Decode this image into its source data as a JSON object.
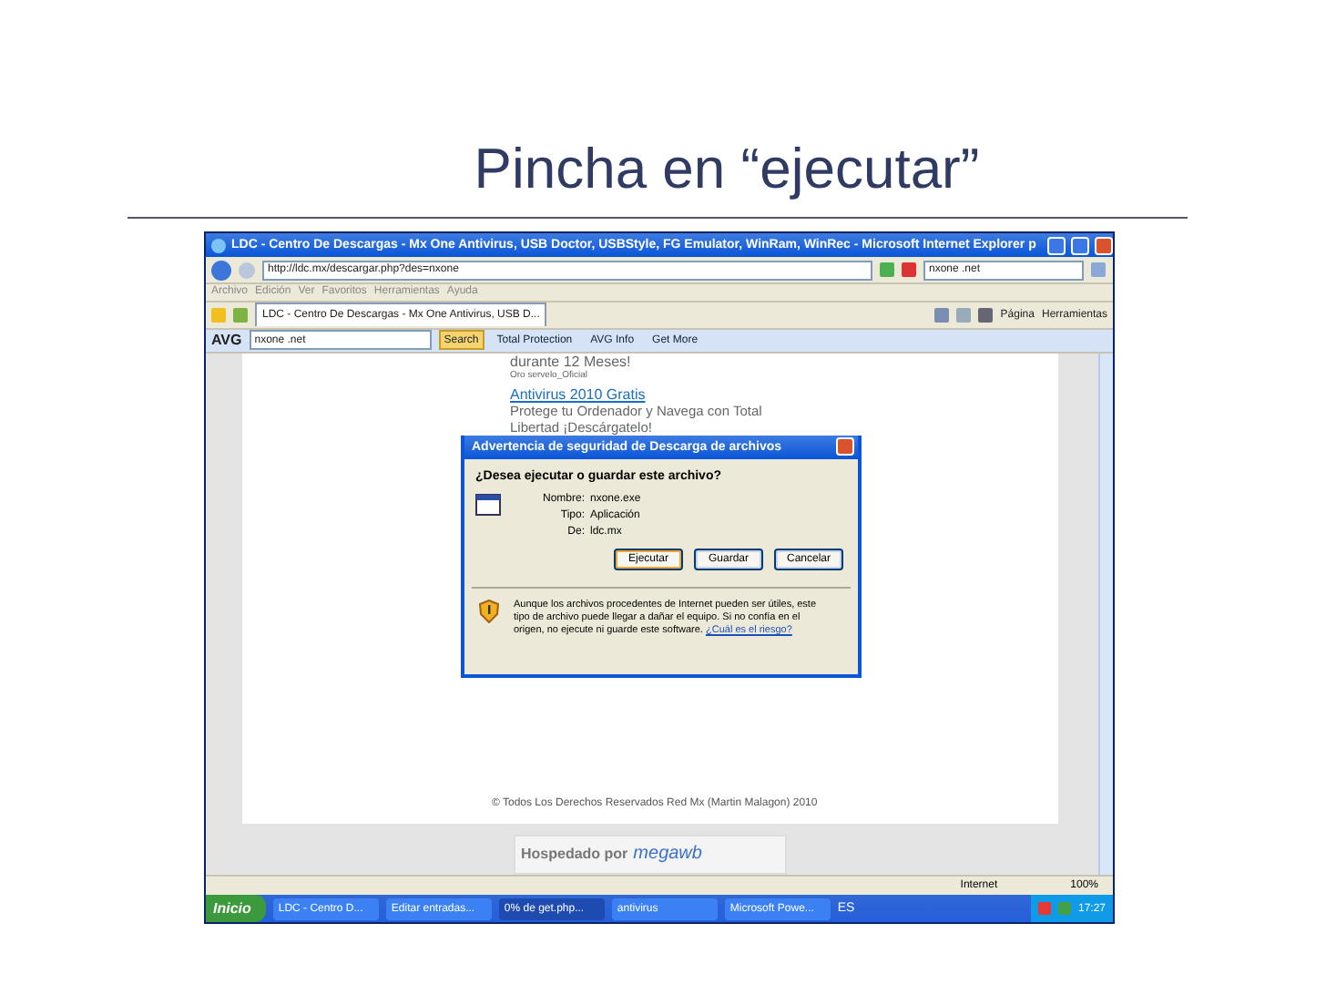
{
  "slide": {
    "title": "Pincha en “ejecutar”"
  },
  "browser": {
    "title": "LDC - Centro De Descargas - Mx One Antivirus, USB Doctor, USBStyle, FG Emulator, WinRam, WinRec - Microsoft Internet Explorer p",
    "address": "http://ldc.mx/descargar.php?des=nxone",
    "search_value": "nxone .net",
    "menu": [
      "Archivo",
      "Edición",
      "Ver",
      "Favoritos",
      "Herramientas",
      "Ayuda"
    ],
    "tab_title": "LDC - Centro De Descargas - Mx One Antivirus, USB D...",
    "commands": [
      "Página",
      "Herramientas"
    ],
    "avg": {
      "brand": "AVG",
      "search_value": "nxone .net",
      "buttons": [
        "Search",
        "Total Protection",
        "AVG Info",
        "Get More"
      ]
    }
  },
  "page": {
    "promo_text": "durante 12 Meses!",
    "promo_source": "Oro servelo_Oficial",
    "link": "Antivirus 2010 Gratis",
    "body": "Protege tu Ordenador y Navega con Total Libertad ¡Descárgatelo!",
    "footer": "© Todos Los Derechos Reservados Red Mx (Martin Malagon) 2010",
    "sponsor_label": "Hospedado por",
    "sponsor_logo": "megawb"
  },
  "dialog": {
    "title": "Advertencia de seguridad de Descarga de archivos",
    "question": "¿Desea ejecutar o guardar este archivo?",
    "fields": [
      {
        "label": "Nombre:",
        "value": "nxone.exe"
      },
      {
        "label": "Tipo:",
        "value": "Aplicación"
      },
      {
        "label": "De:",
        "value": "ldc.mx"
      }
    ],
    "buttons": [
      {
        "label": "Ejecutar",
        "selected": true
      },
      {
        "label": "Guardar",
        "selected": false
      },
      {
        "label": "Cancelar",
        "selected": false
      }
    ],
    "warning": "Aunque los archivos procedentes de Internet pueden ser útiles, este tipo de archivo puede llegar a dañar el equipo. Si no confía en el origen, no ejecute ni guarde este software.",
    "warning_link": "¿Cuál es el riesgo?"
  },
  "status": {
    "zone": "Internet",
    "zoom": "100%"
  },
  "taskbar": {
    "start": "Inicio",
    "tasks": [
      {
        "label": "LDC - Centro D...",
        "selected": false
      },
      {
        "label": "Editar entradas...",
        "selected": false
      },
      {
        "label": "0% de get.php...",
        "selected": true
      },
      {
        "label": "antivirus",
        "selected": false
      },
      {
        "label": "Microsoft Powe...",
        "selected": false
      }
    ],
    "lang": "ES",
    "clock": "17:27"
  }
}
